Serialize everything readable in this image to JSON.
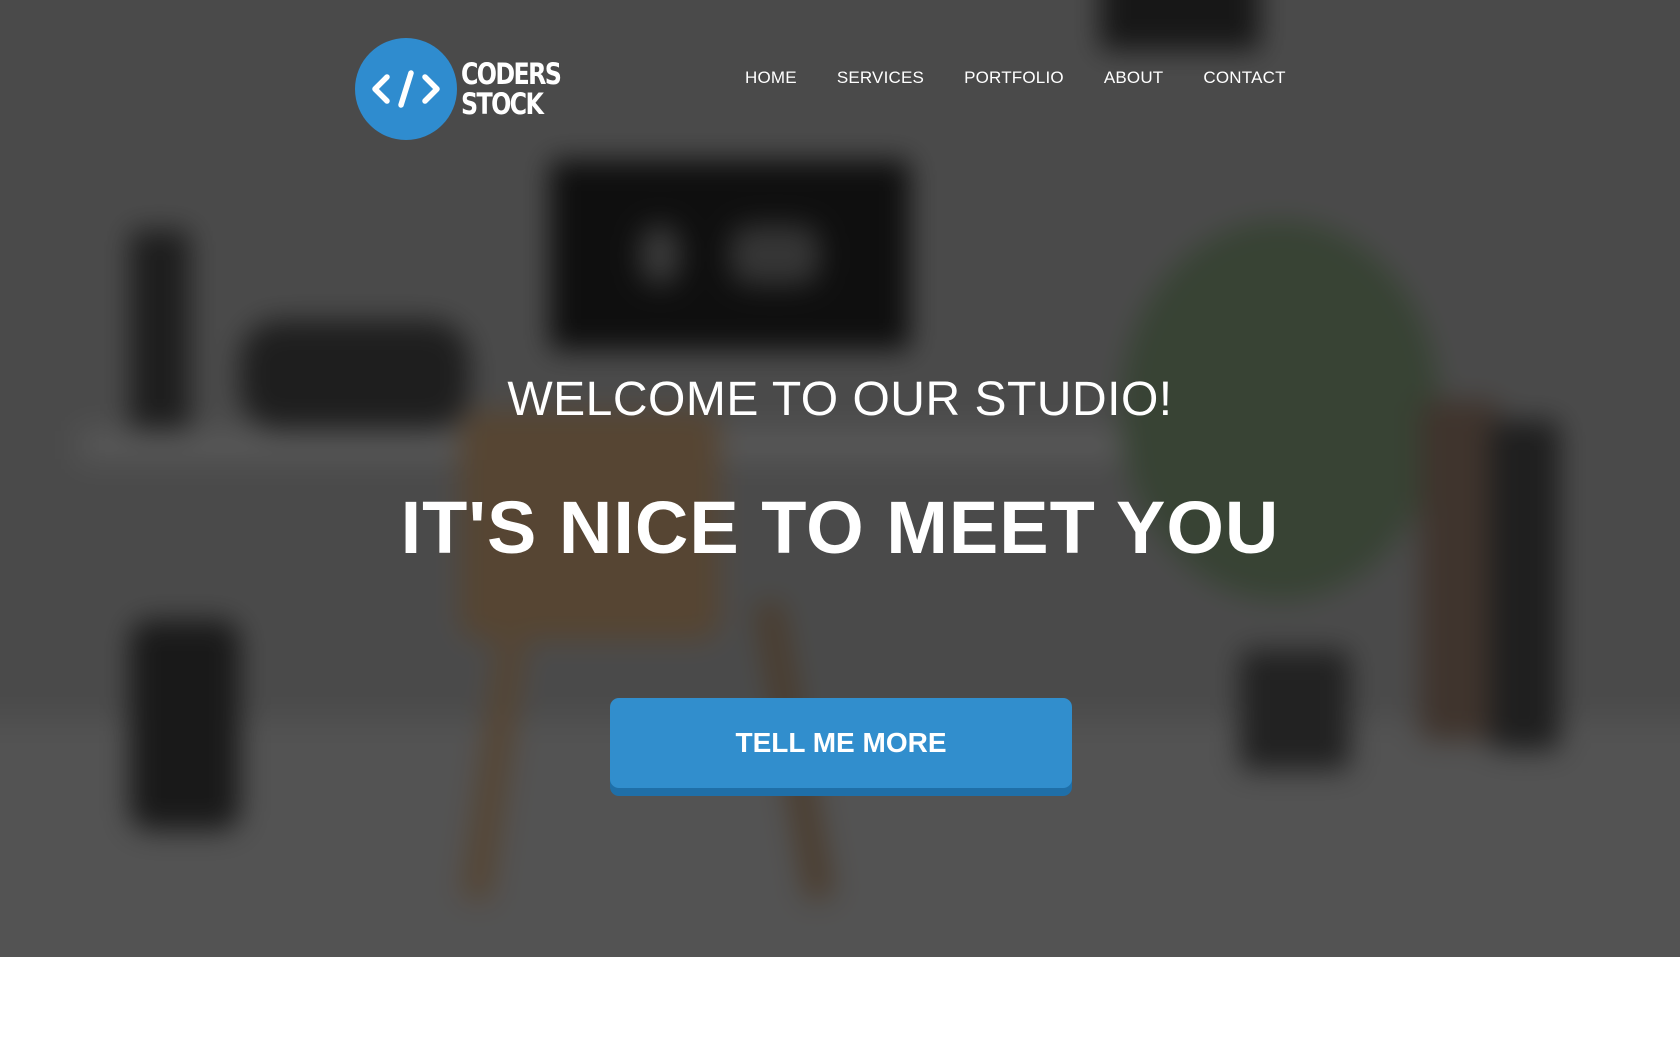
{
  "brand": {
    "logo_symbol": "</>",
    "logo_line1": "CODERS",
    "logo_line2": "STOCK",
    "accent_color": "#2f8ccf"
  },
  "nav": {
    "items": [
      {
        "label": "HOME"
      },
      {
        "label": "SERVICES"
      },
      {
        "label": "PORTFOLIO"
      },
      {
        "label": "ABOUT"
      },
      {
        "label": "CONTACT"
      }
    ]
  },
  "hero": {
    "subheading": "WELCOME TO OUR STUDIO!",
    "heading": "IT'S NICE TO MEET YOU",
    "cta_label": "TELL ME MORE",
    "cta_color": "#318ecd",
    "overlay_color": "#4f4f4f"
  }
}
